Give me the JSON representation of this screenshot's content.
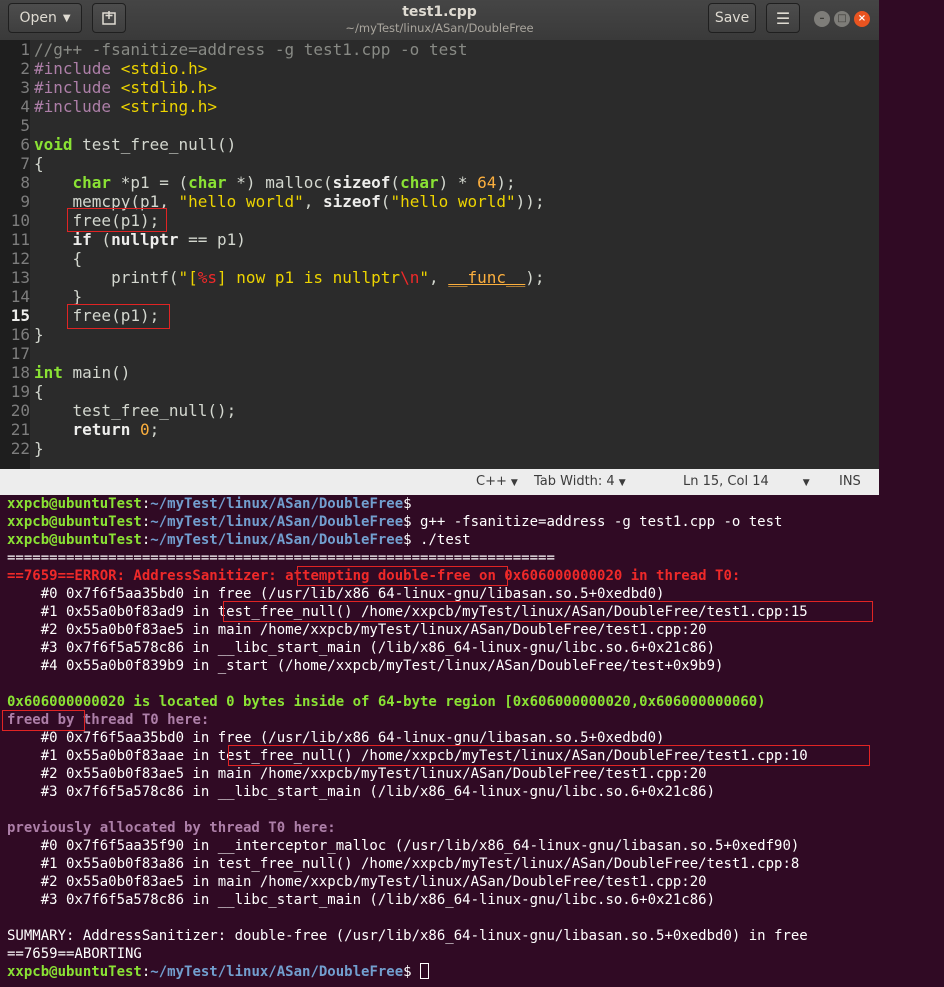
{
  "window": {
    "title": "test1.cpp",
    "path": "~/myTest/linux/ASan/DoubleFree",
    "open_label": "Open",
    "save_label": "Save"
  },
  "editor": {
    "line_numbers": [
      "1",
      "2",
      "3",
      "4",
      "5",
      "6",
      "7",
      "8",
      "9",
      "10",
      "11",
      "12",
      "13",
      "14",
      "15",
      "16",
      "17",
      "18",
      "19",
      "20",
      "21",
      "22"
    ],
    "code": {
      "l1": "//g++ -fsanitize=address -g test1.cpp -o test",
      "l2a": "#include ",
      "l2b": "<stdio.h>",
      "l3a": "#include ",
      "l3b": "<stdlib.h>",
      "l4a": "#include ",
      "l4b": "<string.h>",
      "l6a": "void",
      "l6b": " test_free_null()",
      "l7": "{",
      "l8a": "    ",
      "l8b": "char",
      "l8c": " *p1 = (",
      "l8d": "char",
      "l8e": " *) malloc(",
      "l8f": "sizeof",
      "l8g": "(",
      "l8h": "char",
      "l8i": ") * ",
      "l8j": "64",
      "l8k": ");",
      "l9a": "    memcpy(p1, ",
      "l9b": "\"hello world\"",
      "l9c": ", ",
      "l9d": "sizeof",
      "l9e": "(",
      "l9f": "\"hello world\"",
      "l9g": "));",
      "l10": "    free(p1);",
      "l11a": "    ",
      "l11b": "if",
      "l11c": " (",
      "l11d": "nullptr",
      "l11e": " == p1)",
      "l12": "    {",
      "l13a": "        printf(",
      "l13b": "\"[",
      "l13c": "%s",
      "l13d": "] now p1 is nullptr",
      "l13e": "\\n",
      "l13f": "\"",
      "l13g": ", ",
      "l13h": "__func__",
      "l13i": ");",
      "l14": "    }",
      "l15": "    free(p1);",
      "l16": "}",
      "l18a": "int",
      "l18b": " main()",
      "l19": "{",
      "l20": "    test_free_null();",
      "l21a": "    ",
      "l21b": "return",
      "l21c": " ",
      "l21d": "0",
      "l21e": ";",
      "l22": "}"
    }
  },
  "statusbar": {
    "language": "C++",
    "tab_width": "Tab Width: 4",
    "position": "Ln 15, Col 14",
    "mode": "INS"
  },
  "terminal": {
    "prompt_user": "xxpcb@ubuntuTest",
    "prompt_path": "~/myTest/linux/ASan/DoubleFree",
    "cmd_compile": "g++ -fsanitize=address -g test1.cpp -o test",
    "cmd_run": "./test",
    "sep": "=================================================================",
    "err_a": "==7659==ERROR: AddressSanitizer: ",
    "err_b": "attempting double-free",
    "err_c": " on 0x606000000020 in thread T0:",
    "t1": "    #0 0x7f6f5aa35bd0 in free (/usr/lib/x86_64-linux-gnu/libasan.so.5+0xedbd0)",
    "t2a": "    #1 0x55a0b0f83ad9 in ",
    "t2b": "test_free_null() /home/xxpcb/myTest/linux/ASan/DoubleFree/test1.cpp:15",
    "t3": "    #2 0x55a0b0f83ae5 in main /home/xxpcb/myTest/linux/ASan/DoubleFree/test1.cpp:20",
    "t4": "    #3 0x7f6f5a578c86 in __libc_start_main (/lib/x86_64-linux-gnu/libc.so.6+0x21c86)",
    "t5": "    #4 0x55a0b0f839b9 in _start (/home/xxpcb/myTest/linux/ASan/DoubleFree/test+0x9b9)",
    "loc": "0x606000000020 is located 0 bytes inside of 64-byte region [0x606000000020,0x606000000060)",
    "freed_a": "freed by",
    "freed_b": " thread T0 here:",
    "f1": "    #0 0x7f6f5aa35bd0 in free (/usr/lib/x86_64-linux-gnu/libasan.so.5+0xedbd0)",
    "f2a": "    #1 0x55a0b0f83aae in ",
    "f2b": "test_free_null() /home/xxpcb/myTest/linux/ASan/DoubleFree/test1.cpp:10",
    "f3": "    #2 0x55a0b0f83ae5 in main /home/xxpcb/myTest/linux/ASan/DoubleFree/test1.cpp:20",
    "f4": "    #3 0x7f6f5a578c86 in __libc_start_main (/lib/x86_64-linux-gnu/libc.so.6+0x21c86)",
    "prev": "previously allocated by thread T0 here:",
    "p1": "    #0 0x7f6f5aa35f90 in __interceptor_malloc (/usr/lib/x86_64-linux-gnu/libasan.so.5+0xedf90)",
    "p2": "    #1 0x55a0b0f83a86 in test_free_null() /home/xxpcb/myTest/linux/ASan/DoubleFree/test1.cpp:8",
    "p3": "    #2 0x55a0b0f83ae5 in main /home/xxpcb/myTest/linux/ASan/DoubleFree/test1.cpp:20",
    "p4": "    #3 0x7f6f5a578c86 in __libc_start_main (/lib/x86_64-linux-gnu/libc.so.6+0x21c86)",
    "summary": "SUMMARY: AddressSanitizer: double-free (/usr/lib/x86_64-linux-gnu/libasan.so.5+0xedbd0) in free",
    "abort": "==7659==ABORTING"
  }
}
